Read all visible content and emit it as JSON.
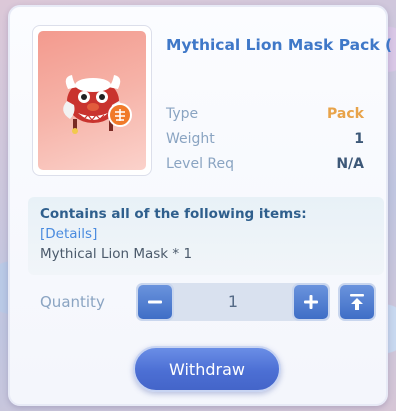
{
  "item": {
    "name": "Mythical Lion Mask Pack (G",
    "icon": "lion-mask-icon"
  },
  "stats": [
    {
      "label": "Type",
      "value": "Pack",
      "color": "#e8a34a"
    },
    {
      "label": "Weight",
      "value": "1",
      "color": "#3d5878"
    },
    {
      "label": "Level Req",
      "value": "N/A",
      "color": "#3d5878"
    }
  ],
  "contents": {
    "title": "Contains all of the following items:",
    "details_link": "[Details]",
    "items": [
      "Mythical Lion Mask * 1"
    ]
  },
  "quantity": {
    "label": "Quantity",
    "value": "1",
    "decrement_icon": "minus-icon",
    "increment_icon": "plus-icon",
    "max_icon": "max-arrow-icon"
  },
  "actions": {
    "withdraw_label": "Withdraw"
  },
  "colors": {
    "accent": "#3f78c8",
    "button": "#4c6fd4"
  }
}
